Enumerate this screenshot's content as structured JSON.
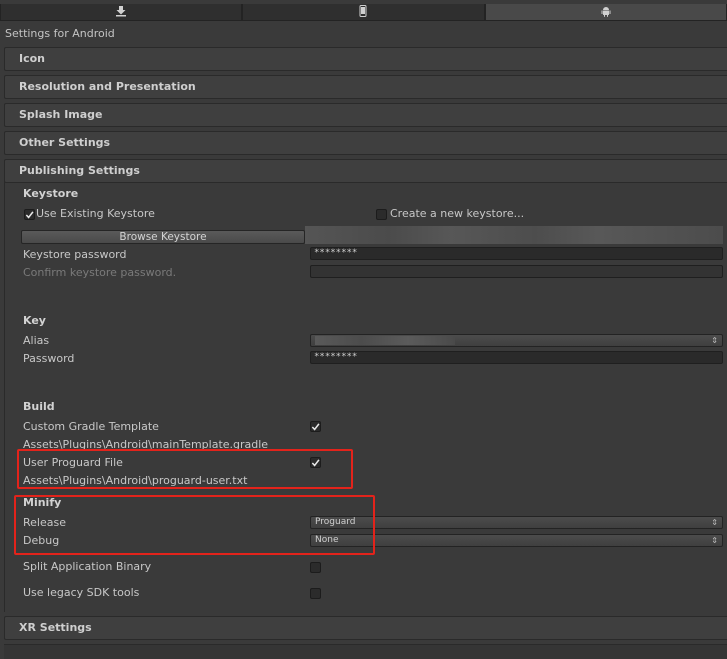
{
  "tabs": [
    {
      "icon": "download-icon",
      "active": false
    },
    {
      "icon": "mobile-phone-icon",
      "active": false
    },
    {
      "icon": "android-icon",
      "active": true
    }
  ],
  "title": "Settings for Android",
  "sections": {
    "icon": "Icon",
    "resolution": "Resolution and Presentation",
    "splash": "Splash Image",
    "other": "Other Settings",
    "publishing": "Publishing Settings",
    "xr": "XR Settings"
  },
  "keystore": {
    "heading": "Keystore",
    "use_existing_label": "Use Existing Keystore",
    "use_existing_checked": true,
    "create_new_label": "Create a new keystore...",
    "create_new_checked": false,
    "browse_button": "Browse Keystore",
    "password_label": "Keystore password",
    "password_value": "********",
    "confirm_label": "Confirm keystore password."
  },
  "key": {
    "heading": "Key",
    "alias_label": "Alias",
    "password_label": "Password",
    "password_value": "********"
  },
  "build": {
    "heading": "Build",
    "custom_gradle_label": "Custom Gradle Template",
    "custom_gradle_checked": true,
    "custom_gradle_path": "Assets\\Plugins\\Android\\mainTemplate.gradle",
    "user_proguard_label": "User Proguard File",
    "user_proguard_checked": true,
    "user_proguard_path": "Assets\\Plugins\\Android\\proguard-user.txt"
  },
  "minify": {
    "heading": "Minify",
    "release_label": "Release",
    "release_value": "Proguard",
    "debug_label": "Debug",
    "debug_value": "None"
  },
  "split_binary": {
    "label": "Split Application Binary",
    "checked": false
  },
  "legacy_sdk": {
    "label": "Use legacy SDK tools",
    "checked": false
  },
  "colors": {
    "highlight": "#e3231b",
    "background": "#3a3a3a"
  }
}
